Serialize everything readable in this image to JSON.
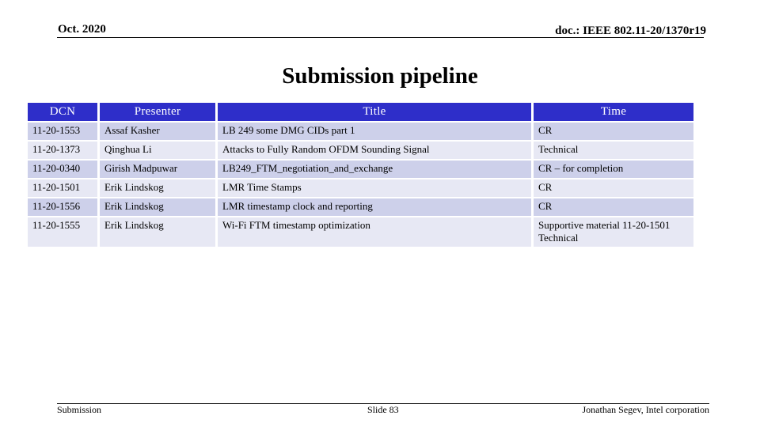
{
  "header": {
    "date": "Oct. 2020",
    "doc_id": "doc.: IEEE 802.11-20/1370r19"
  },
  "slide_title": "Submission pipeline",
  "table": {
    "columns": [
      "DCN",
      "Presenter",
      "Title",
      "Time"
    ],
    "rows": [
      [
        "11-20-1553",
        "Assaf Kasher",
        "LB 249 some DMG CIDs part 1",
        "CR"
      ],
      [
        "11-20-1373",
        "Qinghua Li",
        "Attacks to Fully Random OFDM Sounding Signal",
        "Technical"
      ],
      [
        "11-20-0340",
        "Girish Madpuwar",
        "LB249_FTM_negotiation_and_exchange",
        "CR – for completion"
      ],
      [
        "11-20-1501",
        "Erik Lindskog",
        "LMR Time Stamps",
        "CR"
      ],
      [
        "11-20-1556",
        "Erik Lindskog",
        "LMR timestamp clock and reporting",
        "CR"
      ],
      [
        "11-20-1555",
        "Erik Lindskog",
        "Wi-Fi FTM timestamp optimization",
        "Supportive material 11-20-1501 Technical"
      ]
    ]
  },
  "colors": {
    "header_fill": "#2e2ec9",
    "row_dark": "#cdd0ea",
    "row_light": "#e7e8f4"
  },
  "footer": {
    "left": "Submission",
    "center": "Slide 83",
    "right": "Jonathan Segev, Intel corporation"
  }
}
